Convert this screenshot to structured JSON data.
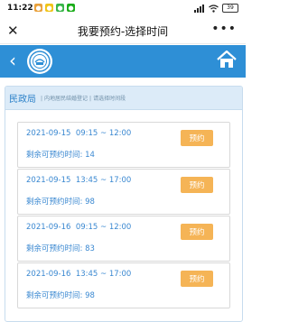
{
  "status_bar": {
    "time": "11:22",
    "battery": "39"
  },
  "title_bar": {
    "close_label": "✕",
    "title": "我要预约-选择时间",
    "more_label": "•••"
  },
  "header": {
    "back_label": "‹"
  },
  "section": {
    "title": "民政局",
    "breadcrumb": [
      "内地居民结婚登记",
      "请选择时间段"
    ]
  },
  "book_label": "预约",
  "slots": [
    {
      "date": "2021-09-15",
      "time": "09:15 ~ 12:00",
      "remaining": "剩余可预约时间: 14"
    },
    {
      "date": "2021-09-15",
      "time": "13:45 ~ 17:00",
      "remaining": "剩余可预约时间: 98"
    },
    {
      "date": "2021-09-16",
      "time": "09:15 ~ 12:00",
      "remaining": "剩余可预约时间: 83"
    },
    {
      "date": "2021-09-16",
      "time": "13:45 ~ 17:00",
      "remaining": "剩余可预约时间: 98"
    }
  ],
  "colors": {
    "header_blue": "#2e8fd6",
    "text_blue": "#3a88d1",
    "button_orange": "#f5b456"
  }
}
